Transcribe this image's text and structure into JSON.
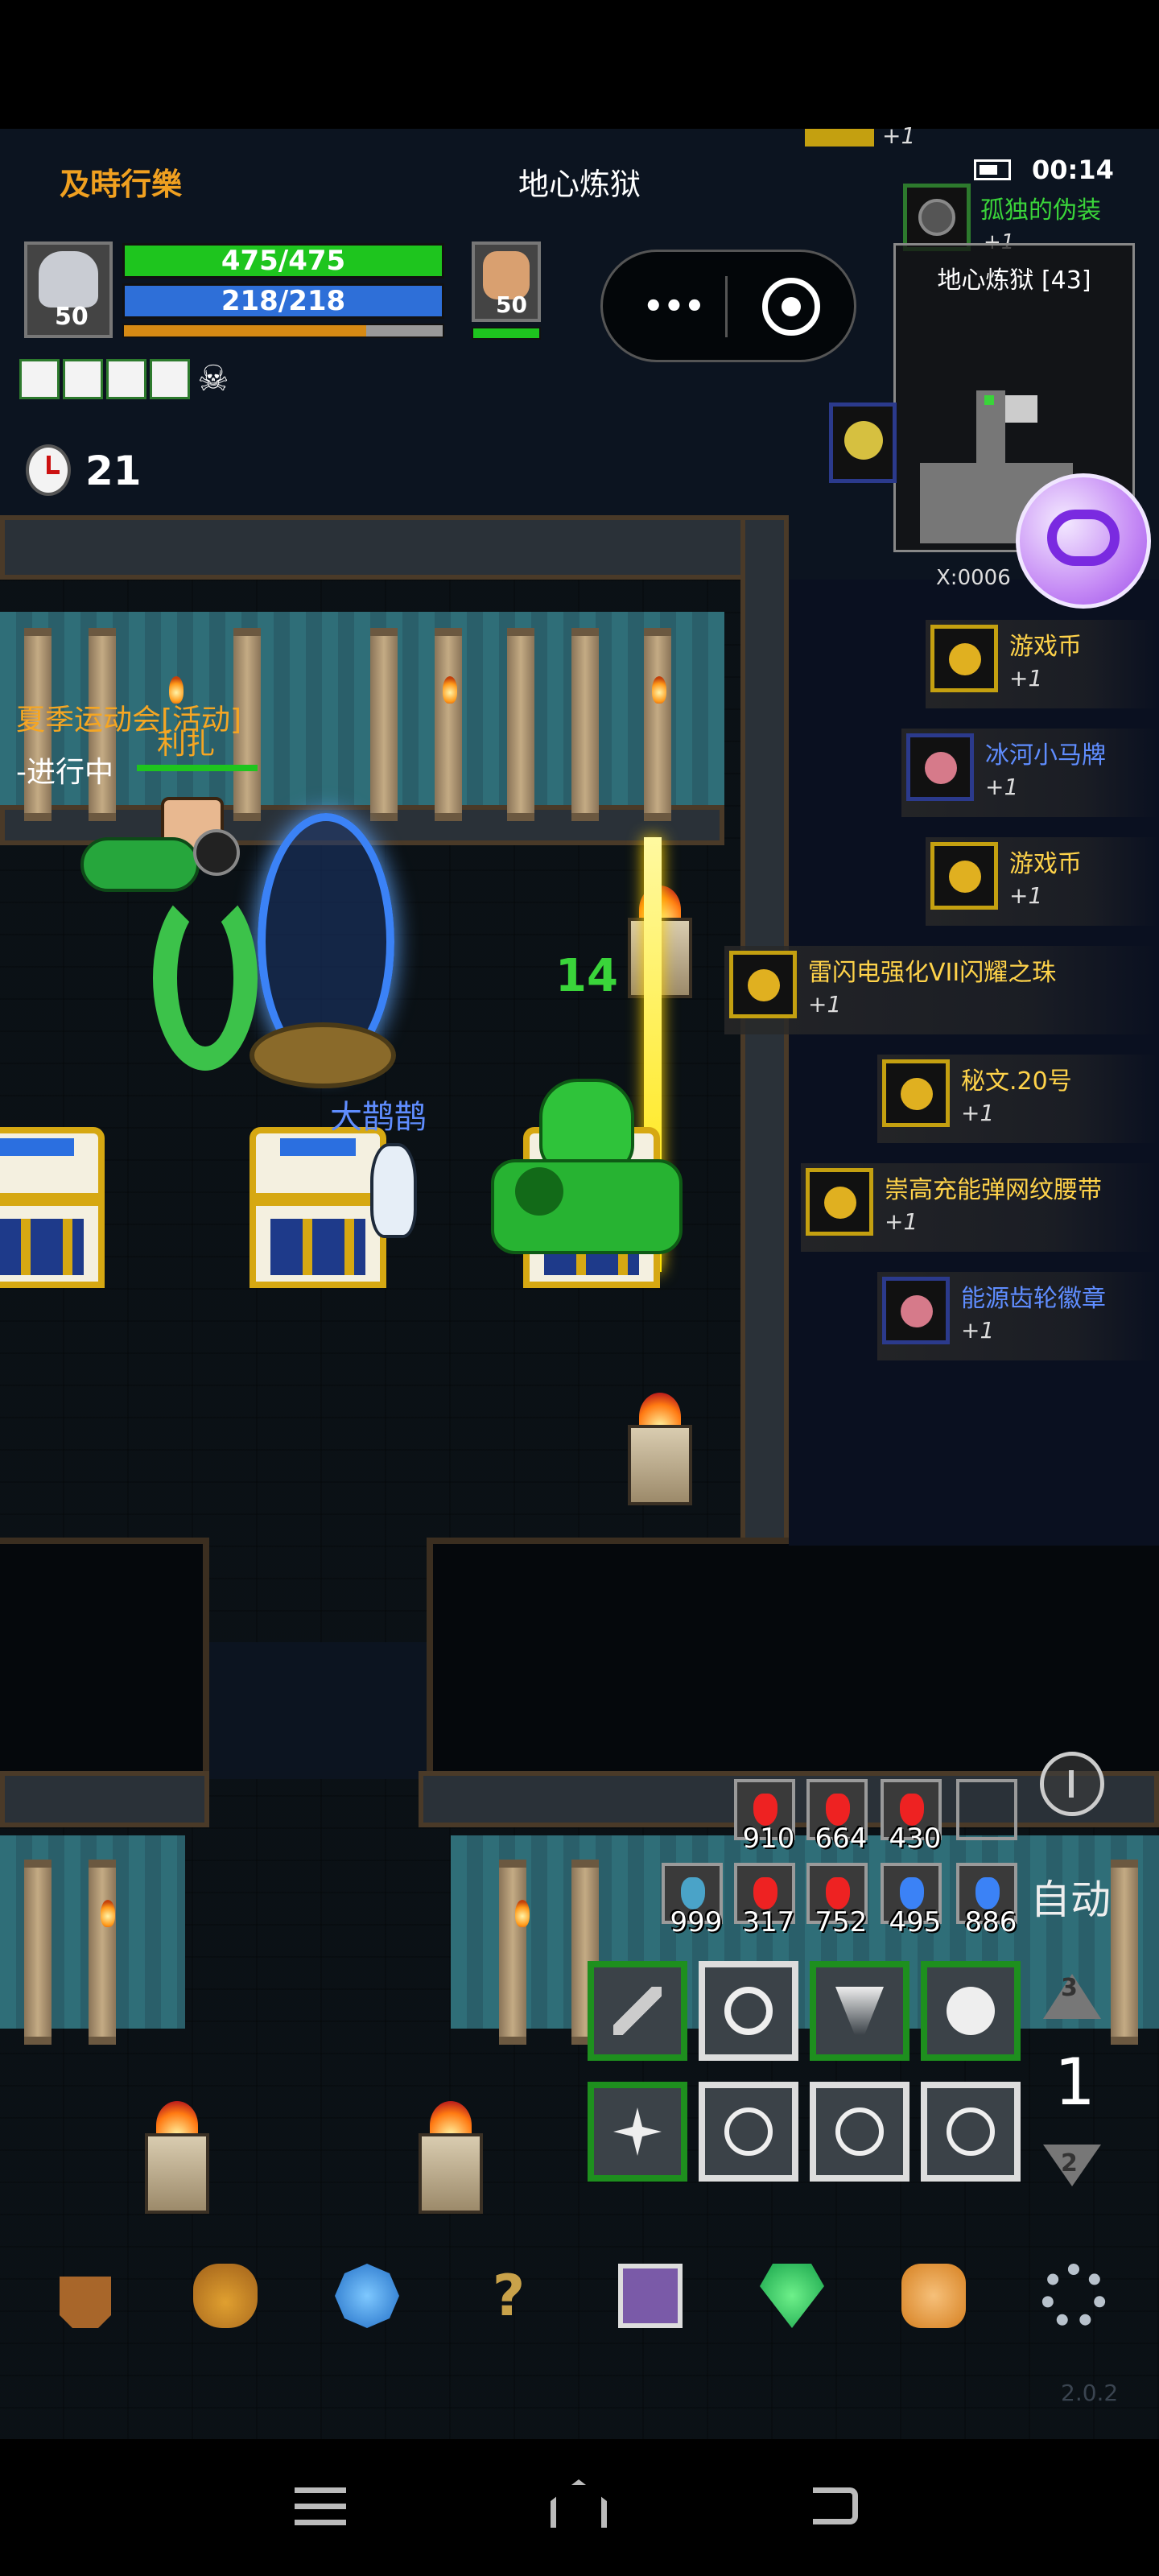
{
  "hud": {
    "player_name": "及時行樂",
    "location_title": "地心炼狱",
    "hp": "475/475",
    "mp": "218/218",
    "player_level": "50",
    "pet_level": "50",
    "timer_value": "21",
    "hp_fraction": 1.0,
    "mp_fraction": 1.0,
    "xp_fraction": 0.76
  },
  "status_bar": {
    "time": "00:14"
  },
  "minimap": {
    "title": "地心炼狱 [43]",
    "coords": "X:0006"
  },
  "top_loot": {
    "name": "孤独的伪装",
    "count": "+1",
    "partial_count": "+1"
  },
  "quest": {
    "title": "夏季运动会[活动]",
    "status": "-进行中"
  },
  "scene_labels": {
    "npc_name": "利扎",
    "pet_name": "大鹊鹊",
    "damage_number": "14"
  },
  "pickups": [
    {
      "name": "游戏币",
      "count": "+1",
      "color": "#ffd34a",
      "icon": "coin-icon"
    },
    {
      "name": "冰河小马牌",
      "count": "+1",
      "color": "#5f8dff",
      "icon": "pony-badge-icon"
    },
    {
      "name": "游戏币",
      "count": "+1",
      "color": "#ffd34a",
      "icon": "coin-icon"
    },
    {
      "name": "雷闪电强化VII闪耀之珠",
      "count": "+1",
      "color": "#ffd34a",
      "icon": "hammer-icon"
    },
    {
      "name": "秘文.20号",
      "count": "+1",
      "color": "#ffd34a",
      "icon": "rune-icon"
    },
    {
      "name": "崇高充能弹网纹腰带",
      "count": "+1",
      "color": "#ffd34a",
      "icon": "belt-icon"
    },
    {
      "name": "能源齿轮徽章",
      "count": "+1",
      "color": "#5f8dff",
      "icon": "gear-badge-icon"
    }
  ],
  "potions_row1": [
    "910",
    "664",
    "430"
  ],
  "potions_row2": [
    "999",
    "317",
    "752",
    "495",
    "886"
  ],
  "auto_label": "自动",
  "skill_page": {
    "up": "3",
    "current": "1",
    "down": "2"
  },
  "version": "2.0.2",
  "colors": {
    "hp": "#1ec51e",
    "mp": "#2e6fd8",
    "xp": "#d68a14",
    "name": "#f0a020",
    "blue_item": "#5f8dff",
    "gold_item": "#ffd34a"
  },
  "menu_icons": [
    "helmet-icon",
    "bag-icon",
    "gem-icon",
    "help-icon",
    "skillbook-icon",
    "crystal-icon",
    "face-icon",
    "settings-icon"
  ],
  "nav_icons": [
    "menu-icon",
    "home-icon",
    "back-icon"
  ]
}
